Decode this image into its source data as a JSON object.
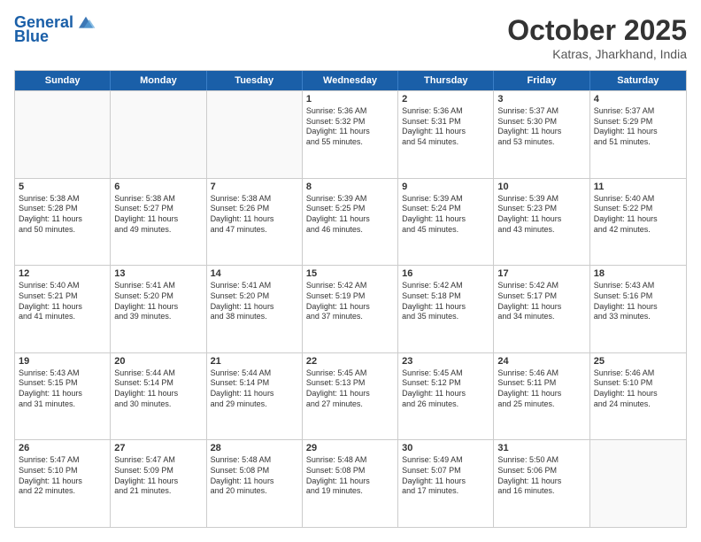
{
  "header": {
    "logo_line1": "General",
    "logo_line2": "Blue",
    "title": "October 2025",
    "subtitle": "Katras, Jharkhand, India"
  },
  "weekdays": [
    "Sunday",
    "Monday",
    "Tuesday",
    "Wednesday",
    "Thursday",
    "Friday",
    "Saturday"
  ],
  "rows": [
    [
      {
        "day": "",
        "lines": []
      },
      {
        "day": "",
        "lines": []
      },
      {
        "day": "",
        "lines": []
      },
      {
        "day": "1",
        "lines": [
          "Sunrise: 5:36 AM",
          "Sunset: 5:32 PM",
          "Daylight: 11 hours",
          "and 55 minutes."
        ]
      },
      {
        "day": "2",
        "lines": [
          "Sunrise: 5:36 AM",
          "Sunset: 5:31 PM",
          "Daylight: 11 hours",
          "and 54 minutes."
        ]
      },
      {
        "day": "3",
        "lines": [
          "Sunrise: 5:37 AM",
          "Sunset: 5:30 PM",
          "Daylight: 11 hours",
          "and 53 minutes."
        ]
      },
      {
        "day": "4",
        "lines": [
          "Sunrise: 5:37 AM",
          "Sunset: 5:29 PM",
          "Daylight: 11 hours",
          "and 51 minutes."
        ]
      }
    ],
    [
      {
        "day": "5",
        "lines": [
          "Sunrise: 5:38 AM",
          "Sunset: 5:28 PM",
          "Daylight: 11 hours",
          "and 50 minutes."
        ]
      },
      {
        "day": "6",
        "lines": [
          "Sunrise: 5:38 AM",
          "Sunset: 5:27 PM",
          "Daylight: 11 hours",
          "and 49 minutes."
        ]
      },
      {
        "day": "7",
        "lines": [
          "Sunrise: 5:38 AM",
          "Sunset: 5:26 PM",
          "Daylight: 11 hours",
          "and 47 minutes."
        ]
      },
      {
        "day": "8",
        "lines": [
          "Sunrise: 5:39 AM",
          "Sunset: 5:25 PM",
          "Daylight: 11 hours",
          "and 46 minutes."
        ]
      },
      {
        "day": "9",
        "lines": [
          "Sunrise: 5:39 AM",
          "Sunset: 5:24 PM",
          "Daylight: 11 hours",
          "and 45 minutes."
        ]
      },
      {
        "day": "10",
        "lines": [
          "Sunrise: 5:39 AM",
          "Sunset: 5:23 PM",
          "Daylight: 11 hours",
          "and 43 minutes."
        ]
      },
      {
        "day": "11",
        "lines": [
          "Sunrise: 5:40 AM",
          "Sunset: 5:22 PM",
          "Daylight: 11 hours",
          "and 42 minutes."
        ]
      }
    ],
    [
      {
        "day": "12",
        "lines": [
          "Sunrise: 5:40 AM",
          "Sunset: 5:21 PM",
          "Daylight: 11 hours",
          "and 41 minutes."
        ]
      },
      {
        "day": "13",
        "lines": [
          "Sunrise: 5:41 AM",
          "Sunset: 5:20 PM",
          "Daylight: 11 hours",
          "and 39 minutes."
        ]
      },
      {
        "day": "14",
        "lines": [
          "Sunrise: 5:41 AM",
          "Sunset: 5:20 PM",
          "Daylight: 11 hours",
          "and 38 minutes."
        ]
      },
      {
        "day": "15",
        "lines": [
          "Sunrise: 5:42 AM",
          "Sunset: 5:19 PM",
          "Daylight: 11 hours",
          "and 37 minutes."
        ]
      },
      {
        "day": "16",
        "lines": [
          "Sunrise: 5:42 AM",
          "Sunset: 5:18 PM",
          "Daylight: 11 hours",
          "and 35 minutes."
        ]
      },
      {
        "day": "17",
        "lines": [
          "Sunrise: 5:42 AM",
          "Sunset: 5:17 PM",
          "Daylight: 11 hours",
          "and 34 minutes."
        ]
      },
      {
        "day": "18",
        "lines": [
          "Sunrise: 5:43 AM",
          "Sunset: 5:16 PM",
          "Daylight: 11 hours",
          "and 33 minutes."
        ]
      }
    ],
    [
      {
        "day": "19",
        "lines": [
          "Sunrise: 5:43 AM",
          "Sunset: 5:15 PM",
          "Daylight: 11 hours",
          "and 31 minutes."
        ]
      },
      {
        "day": "20",
        "lines": [
          "Sunrise: 5:44 AM",
          "Sunset: 5:14 PM",
          "Daylight: 11 hours",
          "and 30 minutes."
        ]
      },
      {
        "day": "21",
        "lines": [
          "Sunrise: 5:44 AM",
          "Sunset: 5:14 PM",
          "Daylight: 11 hours",
          "and 29 minutes."
        ]
      },
      {
        "day": "22",
        "lines": [
          "Sunrise: 5:45 AM",
          "Sunset: 5:13 PM",
          "Daylight: 11 hours",
          "and 27 minutes."
        ]
      },
      {
        "day": "23",
        "lines": [
          "Sunrise: 5:45 AM",
          "Sunset: 5:12 PM",
          "Daylight: 11 hours",
          "and 26 minutes."
        ]
      },
      {
        "day": "24",
        "lines": [
          "Sunrise: 5:46 AM",
          "Sunset: 5:11 PM",
          "Daylight: 11 hours",
          "and 25 minutes."
        ]
      },
      {
        "day": "25",
        "lines": [
          "Sunrise: 5:46 AM",
          "Sunset: 5:10 PM",
          "Daylight: 11 hours",
          "and 24 minutes."
        ]
      }
    ],
    [
      {
        "day": "26",
        "lines": [
          "Sunrise: 5:47 AM",
          "Sunset: 5:10 PM",
          "Daylight: 11 hours",
          "and 22 minutes."
        ]
      },
      {
        "day": "27",
        "lines": [
          "Sunrise: 5:47 AM",
          "Sunset: 5:09 PM",
          "Daylight: 11 hours",
          "and 21 minutes."
        ]
      },
      {
        "day": "28",
        "lines": [
          "Sunrise: 5:48 AM",
          "Sunset: 5:08 PM",
          "Daylight: 11 hours",
          "and 20 minutes."
        ]
      },
      {
        "day": "29",
        "lines": [
          "Sunrise: 5:48 AM",
          "Sunset: 5:08 PM",
          "Daylight: 11 hours",
          "and 19 minutes."
        ]
      },
      {
        "day": "30",
        "lines": [
          "Sunrise: 5:49 AM",
          "Sunset: 5:07 PM",
          "Daylight: 11 hours",
          "and 17 minutes."
        ]
      },
      {
        "day": "31",
        "lines": [
          "Sunrise: 5:50 AM",
          "Sunset: 5:06 PM",
          "Daylight: 11 hours",
          "and 16 minutes."
        ]
      },
      {
        "day": "",
        "lines": []
      }
    ]
  ]
}
